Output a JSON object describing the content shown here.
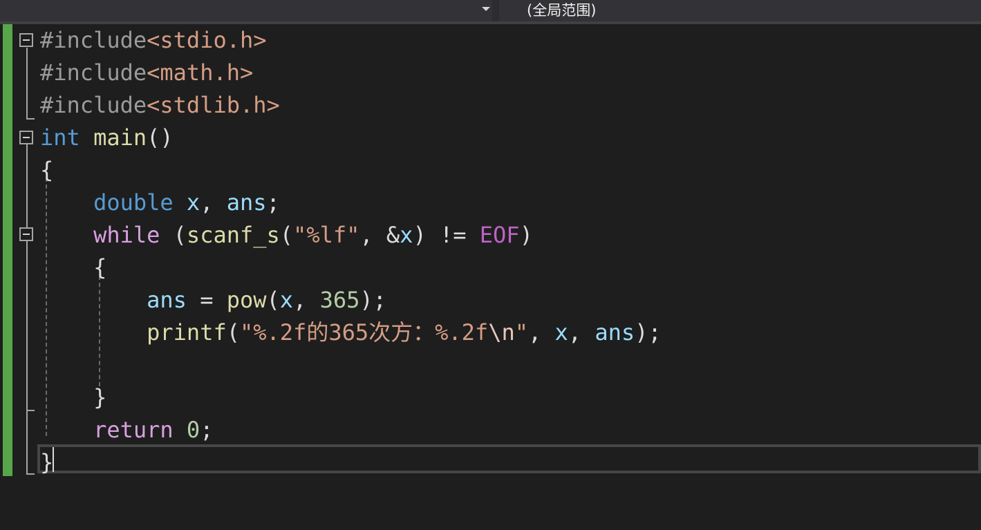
{
  "navigation": {
    "member_dropdown_value": "",
    "scope_label": "(全局范围)"
  },
  "colors": {
    "editor_background": "#1e1e1e",
    "change_bar": "#57a64a",
    "preprocessor": "#9b9b9b",
    "string": "#d69d85",
    "keyword": "#569cd6",
    "control_keyword": "#d8a0df",
    "function": "#dcdcaa",
    "variable": "#9cdcfe",
    "number": "#b5cea8",
    "macro": "#bd63c5",
    "plain": "#dcdcdc"
  },
  "code": {
    "lines": [
      [
        {
          "t": "#include",
          "c": "pre"
        },
        {
          "t": "<stdio.h>",
          "c": "inc"
        }
      ],
      [
        {
          "t": "#include",
          "c": "pre"
        },
        {
          "t": "<math.h>",
          "c": "inc"
        }
      ],
      [
        {
          "t": "#include",
          "c": "pre"
        },
        {
          "t": "<stdlib.h>",
          "c": "inc"
        }
      ],
      [
        {
          "t": "int",
          "c": "kw"
        },
        {
          "t": " ",
          "c": "plain"
        },
        {
          "t": "main",
          "c": "fn"
        },
        {
          "t": "()",
          "c": "plain"
        }
      ],
      [
        {
          "t": "{",
          "c": "plain"
        }
      ],
      [
        {
          "t": "    ",
          "c": "plain"
        },
        {
          "t": "double",
          "c": "kw"
        },
        {
          "t": " ",
          "c": "plain"
        },
        {
          "t": "x",
          "c": "var"
        },
        {
          "t": ", ",
          "c": "plain"
        },
        {
          "t": "ans",
          "c": "var"
        },
        {
          "t": ";",
          "c": "plain"
        }
      ],
      [
        {
          "t": "    ",
          "c": "plain"
        },
        {
          "t": "while",
          "c": "ctrl"
        },
        {
          "t": " (",
          "c": "plain"
        },
        {
          "t": "scanf_s",
          "c": "fn"
        },
        {
          "t": "(",
          "c": "plain"
        },
        {
          "t": "\"%lf\"",
          "c": "str"
        },
        {
          "t": ", &",
          "c": "plain"
        },
        {
          "t": "x",
          "c": "var"
        },
        {
          "t": ") != ",
          "c": "plain"
        },
        {
          "t": "EOF",
          "c": "macro"
        },
        {
          "t": ")",
          "c": "plain"
        }
      ],
      [
        {
          "t": "    {",
          "c": "plain"
        }
      ],
      [
        {
          "t": "        ",
          "c": "plain"
        },
        {
          "t": "ans",
          "c": "var"
        },
        {
          "t": " = ",
          "c": "plain"
        },
        {
          "t": "pow",
          "c": "fn"
        },
        {
          "t": "(",
          "c": "plain"
        },
        {
          "t": "x",
          "c": "var"
        },
        {
          "t": ", ",
          "c": "plain"
        },
        {
          "t": "365",
          "c": "num"
        },
        {
          "t": ");",
          "c": "plain"
        }
      ],
      [
        {
          "t": "        ",
          "c": "plain"
        },
        {
          "t": "printf",
          "c": "fn"
        },
        {
          "t": "(",
          "c": "plain"
        },
        {
          "t": "\"%.2f的365次方：%.2f",
          "c": "str"
        },
        {
          "t": "\\n",
          "c": "esc"
        },
        {
          "t": "\"",
          "c": "str"
        },
        {
          "t": ", ",
          "c": "plain"
        },
        {
          "t": "x",
          "c": "var"
        },
        {
          "t": ", ",
          "c": "plain"
        },
        {
          "t": "ans",
          "c": "var"
        },
        {
          "t": ");",
          "c": "plain"
        }
      ],
      [
        {
          "t": "",
          "c": "plain"
        }
      ],
      [
        {
          "t": "    }",
          "c": "plain"
        }
      ],
      [
        {
          "t": "    ",
          "c": "plain"
        },
        {
          "t": "return",
          "c": "ctrl"
        },
        {
          "t": " ",
          "c": "plain"
        },
        {
          "t": "0",
          "c": "num"
        },
        {
          "t": ";",
          "c": "plain"
        }
      ],
      [
        {
          "t": "}",
          "c": "plain"
        }
      ]
    ]
  }
}
